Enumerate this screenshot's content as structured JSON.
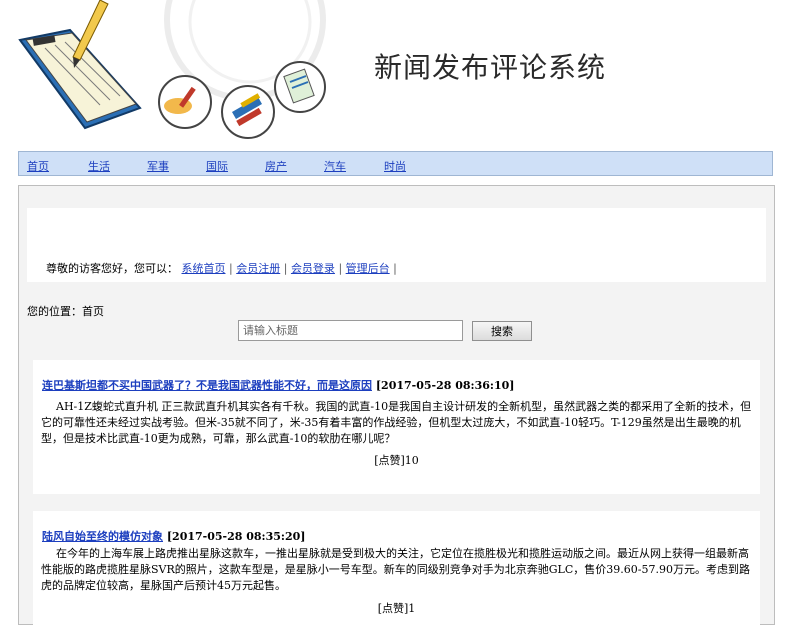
{
  "header": {
    "title": "新闻发布评论系统"
  },
  "nav": {
    "items": [
      "首页",
      "生活",
      "军事",
      "国际",
      "房产",
      "汽车",
      "时尚"
    ]
  },
  "welcome": {
    "text": "尊敬的访客您好，您可以：",
    "links": [
      "系统首页",
      "会员注册",
      "会员登录",
      "管理后台"
    ],
    "separator": "|"
  },
  "breadcrumb": {
    "text": "您的位置：首页"
  },
  "search": {
    "placeholder": "请输入标题",
    "button_label": "搜索"
  },
  "articles": [
    {
      "title": "连巴基斯坦都不买中国武器了？不是我国武器性能不好，而是这原因",
      "date": "[2017-05-28 08:36:10]",
      "body": "AH-1Z蝮蛇式直升机 正三款武直升机其实各有千秋。我国的武直-10是我国自主设计研发的全新机型，虽然武器之类的都采用了全新的技术，但它的可靠性还未经过实战考验。但米-35就不同了，米-35有着丰富的作战经验，但机型太过庞大，不如武直-10轻巧。T-129虽然是出生最晚的机型，但是技术比武直-10更为成熟，可靠，那么武直-10的软肋在哪儿呢？",
      "likes": "[点赞]10"
    },
    {
      "title": "陆风自始至终的模仿对象",
      "date": "[2017-05-28 08:35:20]",
      "body": "在今年的上海车展上路虎推出星脉这款车，一推出星脉就是受到极大的关注，它定位在揽胜极光和揽胜运动版之间。最近从网上获得一组最新高性能版的路虎揽胜星脉SVR的照片，这款车型是，是星脉小一号车型。新车的同级别竞争对手为北京奔驰GLC，售价39.60-57.90万元。考虑到路虎的品牌定位较高，星脉国产后预计45万元起售。",
      "likes": "[点赞]1"
    }
  ]
}
